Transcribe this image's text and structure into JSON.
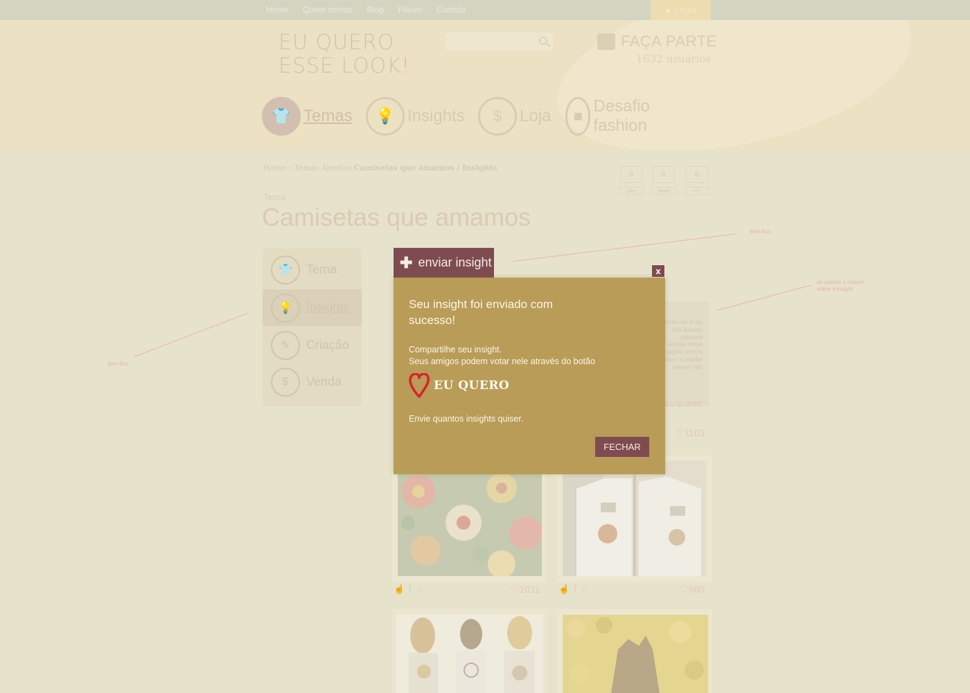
{
  "topbar": {
    "nav": [
      "Home",
      "Quem somos",
      "Blog",
      "Fórum",
      "Contato"
    ],
    "login": "Login"
  },
  "header": {
    "logo_line1": "EU QUERO",
    "logo_line2": "ESSE LOOK",
    "logo_bang": "!",
    "faca_title": "FAÇA PARTE",
    "faca_users": "1632 usuários"
  },
  "mainnav": [
    {
      "label": "Temas",
      "icon": "tshirt-icon",
      "active": true
    },
    {
      "label": "Insights",
      "icon": "lightbulb-icon"
    },
    {
      "label": "Loja",
      "icon": "money-tag-icon"
    },
    {
      "label": "Desafio fashion",
      "icon": "puzzle-icon"
    }
  ],
  "breadcrumb": {
    "parts": "Home › Temas Abertos ",
    "current": "Camisetas que amamos / Insights"
  },
  "social": [
    {
      "count": "0",
      "label": "Like"
    },
    {
      "count": "0",
      "label": "Tweet"
    },
    {
      "count": "0",
      "label": "+1"
    }
  ],
  "page": {
    "kicker": "Tema",
    "title": "Camisetas que amamos"
  },
  "sidebar": [
    {
      "label": "Tema",
      "icon": "tshirt-icon"
    },
    {
      "label": "Insights",
      "icon": "lightbulb-icon",
      "active": true
    },
    {
      "label": "Criação",
      "icon": "pencil-icon"
    },
    {
      "label": "Venda",
      "icon": "money-tag-icon"
    }
  ],
  "notes": {
    "item_fixo_top": "item fixo",
    "hover_note_1": "ao passar o mouse",
    "hover_note_2": "sobre o insight",
    "item_fixo_left": "item fixo"
  },
  "cards": {
    "text_snippet": "lorem dui in est vida aliquam vulputate ultrices metus sagittis enim in tique. Curabitur semper nibh",
    "eu_quero_faint": "EU QUERO",
    "votes": [
      "1103",
      "1011",
      "980"
    ]
  },
  "modal": {
    "tab_label": "enviar insight",
    "close_x": "x",
    "title": "Seu insight foi enviado com sucesso!",
    "body_line1": "Compartilhe seu insight.",
    "body_line2": "Seus amigos podem votar nele através do botão",
    "brand": "EU QUERO",
    "send_more": "Envie quantos insights quiser.",
    "close_button": "FECHAR"
  },
  "colors": {
    "modal_bg": "#b89c58",
    "accent": "#7e4c50",
    "heart": "#d8232a"
  }
}
